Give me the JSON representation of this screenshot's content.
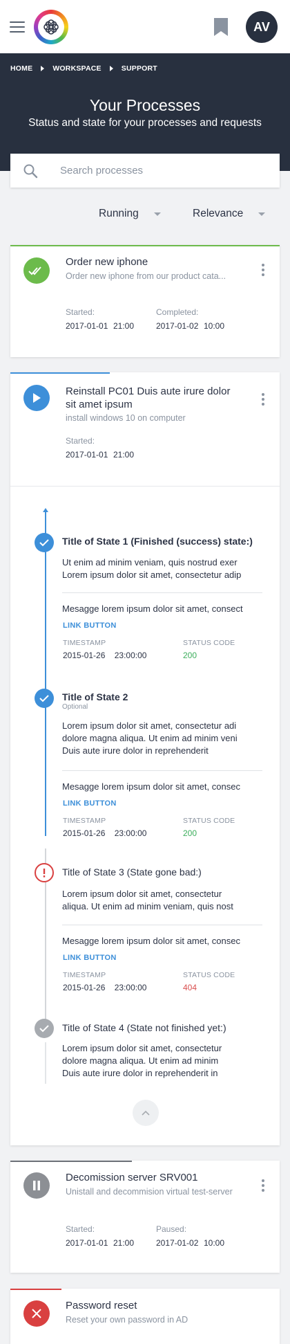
{
  "app": {
    "avatar_initials": "AV"
  },
  "breadcrumb": [
    "HOME",
    "WORKSPACE",
    "SUPPORT"
  ],
  "header": {
    "title": "Your Processes",
    "subtitle": "Status and state for your processes and requests"
  },
  "search": {
    "placeholder": "Search processes",
    "value": ""
  },
  "filters": {
    "status": "Running",
    "sort": "Relevance"
  },
  "colors": {
    "success": "#6cbb4b",
    "running": "#3d8fd9",
    "paused": "#8c8f94",
    "error": "#d94040",
    "pending": "#a7abb0",
    "status_ok": "#3cae5c",
    "status_bad": "#d95050"
  },
  "processes": [
    {
      "status": "completed",
      "status_icon": "double-check-icon",
      "title": "Order new iphone",
      "description": "Order new iphone from our product cata...",
      "meta": [
        {
          "label": "Started:",
          "date": "2017-01-01",
          "time": "21:00"
        },
        {
          "label": "Completed:",
          "date": "2017-01-02",
          "time": "10:00"
        }
      ]
    },
    {
      "status": "running",
      "status_icon": "play-icon",
      "progress": 0.37,
      "title_line1": "Reinstall PC01 Duis aute irure dolor",
      "title_line2": "sit amet ipsum",
      "description": "install windows 10 on computer",
      "meta": [
        {
          "label": "Started:",
          "date": "2017-01-01",
          "time": "21:00"
        }
      ],
      "states": [
        {
          "kind": "success",
          "title": "Title of State 1 (Finished (success) state:)",
          "optional": "",
          "text": [
            "Ut enim ad minim veniam, quis nostrud exer",
            "Lorem ipsum dolor sit amet, consectetur adip"
          ],
          "message": "Mesagge lorem ipsum dolor sit amet, consect",
          "link": "LINK BUTTON",
          "timestamp_label": "TIMESTAMP",
          "timestamp": "2015-01-26    23:00:00",
          "status_label": "STATUS CODE",
          "status_code": "200"
        },
        {
          "kind": "success",
          "title": "Title of State  2",
          "optional": "Optional",
          "text": [
            "Lorem ipsum dolor sit amet, consectetur adi",
            "dolore magna aliqua. Ut enim ad minim veni",
            "Duis aute irure dolor in reprehenderit"
          ],
          "message": "Mesagge lorem ipsum dolor sit amet, consec",
          "link": "LINK BUTTON",
          "timestamp_label": "TIMESTAMP",
          "timestamp": "2015-01-26    23:00:00",
          "status_label": "STATUS CODE",
          "status_code": "200"
        },
        {
          "kind": "error",
          "title": "Title of State  3 (State gone bad:)",
          "optional": "",
          "text": [
            "Lorem ipsum dolor sit amet, consectetur",
            "aliqua. Ut enim ad minim veniam, quis nost"
          ],
          "message": "Mesagge lorem ipsum dolor sit amet, consec",
          "link": "LINK BUTTON",
          "timestamp_label": "TIMESTAMP",
          "timestamp": "2015-01-26    23:00:00",
          "status_label": "STATUS CODE",
          "status_code": "404"
        },
        {
          "kind": "pending",
          "title": "Title of State 4 (State not finished yet:)",
          "optional": "",
          "text": [
            "Lorem ipsum dolor sit amet, consectetur",
            "dolore magna aliqua. Ut enim ad minim",
            "Duis aute irure dolor in reprehenderit in"
          ]
        }
      ]
    },
    {
      "status": "paused",
      "status_icon": "pause-icon",
      "progress": 0.45,
      "title": "Decomission server SRV001",
      "description": "Unistall and decommision virtual test-server",
      "meta": [
        {
          "label": "Started:",
          "date": "2017-01-01",
          "time": "21:00"
        },
        {
          "label": "Paused:",
          "date": "2017-01-02",
          "time": "10:00"
        }
      ]
    },
    {
      "status": "failed",
      "status_icon": "close-icon",
      "progress": 0.19,
      "title": "Password reset",
      "description": "Reset your own password in AD"
    }
  ]
}
